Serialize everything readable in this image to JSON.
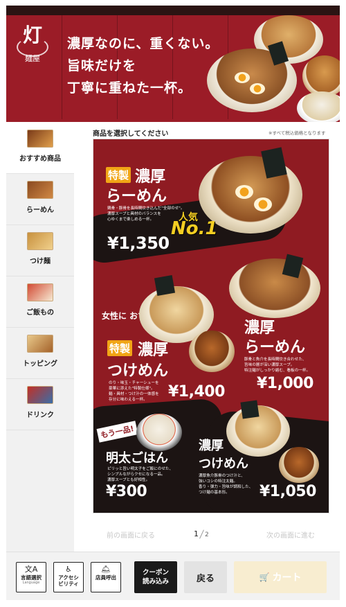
{
  "header": {
    "logo_main": "灯",
    "logo_sub": "麺屋",
    "catch_lines": [
      "濃厚なのに、重くない。",
      "旨味だけを",
      "丁寧に重ねた一杯。"
    ]
  },
  "sidebar": {
    "items": [
      {
        "label": "おすすめ商品",
        "icon": "ramen-egg-thumb",
        "active": true
      },
      {
        "label": "らーめん",
        "icon": "ramen-thumb",
        "active": false
      },
      {
        "label": "つけ麺",
        "icon": "tsukemen-thumb",
        "active": false
      },
      {
        "label": "ご飯もの",
        "icon": "rice-bowl-thumb",
        "active": false
      },
      {
        "label": "トッピング",
        "icon": "topping-thumb",
        "active": false
      },
      {
        "label": "ドリンク",
        "icon": "drink-thumb",
        "active": false
      }
    ]
  },
  "main": {
    "title": "商品を選択してください",
    "tax_note": "※すべて税込価格となります"
  },
  "poster": {
    "popular": "人気",
    "no1": "No.1",
    "women_rec": "女性に\nおすすめ!",
    "mou_ippin": "もう一品!",
    "items": [
      {
        "tag": "特製",
        "name1": "濃厚",
        "name2": "らーめん",
        "desc": "鶏骨・豚骨を長時間炊き込んだ\"全部のせ\"。\n濃厚スープと具材のバランスを\n心ゆくまで楽しめる一杯。",
        "price": "¥1,350"
      },
      {
        "name1": "濃厚",
        "name2": "らーめん",
        "desc": "豚骨と魚介を長時間炊き合わせた、\n旨味の層が深い濃厚スープ。\n特注麺がしっかり絡む、看板の一杯。",
        "price": "¥1,000"
      },
      {
        "tag": "特製",
        "name1": "濃厚",
        "name2": "つけめん",
        "desc": "のり・味玉・チャーシューを\n豪華に添えた\"特製仕様\"。\n麺・具材・つけ汁の一体感を\n存分に味わえる一杯。",
        "price": "¥1,400"
      },
      {
        "name1": "明太ごはん",
        "desc": "ピリッと旨い明太子をご飯にのせた、\nシンプルながらクセになる一品。\n濃厚スープとも好相性。",
        "price": "¥300"
      },
      {
        "name1": "濃厚",
        "name2": "つけめん",
        "desc": "濃厚魚介豚骨のつけ汁と、\n強いコシの特注太麺。\n香り・弾力・旨味が調和した、\nつけ麺の基本形。",
        "price": "¥1,050"
      }
    ]
  },
  "pager": {
    "prev_label": "前の画面に戻る",
    "next_label": "次の画面に進む",
    "current": "1",
    "total": "2"
  },
  "bottom": {
    "language": {
      "label": "言語選択",
      "sub": "Language",
      "icon": "translate-icon"
    },
    "accessibility": {
      "label": "アクセシ\nビリティ",
      "icon": "accessibility-icon"
    },
    "call_staff": {
      "label": "店員呼出",
      "icon": "bell-hand-icon"
    },
    "coupon_label": "クーポン\n読み込み",
    "back_label": "戻る",
    "cart_label": "カート"
  },
  "colors": {
    "banner_red": "#9b1c27",
    "poster_red": "#8f1b22",
    "accent_yellow": "#f4ce22",
    "tag_orange": "#f1a516",
    "cart_disabled": "#f8edd0"
  }
}
